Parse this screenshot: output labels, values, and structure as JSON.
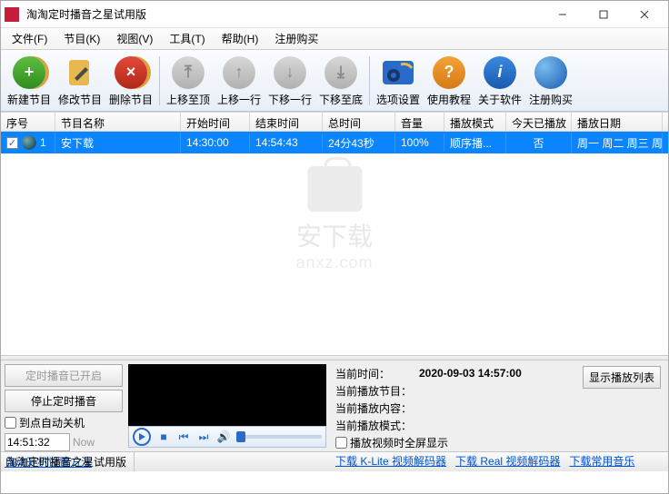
{
  "title": "淘淘定时播音之星试用版",
  "menu": [
    "文件(F)",
    "节目(K)",
    "视图(V)",
    "工具(T)",
    "帮助(H)",
    "注册购买"
  ],
  "toolbar": {
    "new": "新建节目",
    "edit": "修改节目",
    "delete": "删除节目",
    "moveTop": "上移至顶",
    "moveUp": "上移一行",
    "moveDown": "下移一行",
    "moveBottom": "下移至底",
    "options": "选项设置",
    "tutorial": "使用教程",
    "about": "关于软件",
    "register": "注册购买"
  },
  "columns": {
    "seq": "序号",
    "name": "节目名称",
    "start": "开始时间",
    "end": "结束时间",
    "total": "总时间",
    "vol": "音量",
    "mode": "播放模式",
    "today": "今天已播放",
    "date": "播放日期"
  },
  "rows": [
    {
      "seq": "1",
      "name": "安下载",
      "start": "14:30:00",
      "end": "14:54:43",
      "total": "24分43秒",
      "vol": "100%",
      "mode": "顺序播...",
      "today": "否",
      "date": "周一 周二 周三 周..."
    }
  ],
  "watermark": {
    "line1": "安下载",
    "line2": "anxz.com"
  },
  "bottom": {
    "timerOn": "定时播音已开启",
    "stopTimer": "停止定时播音",
    "autoShutdown": "到点自动关机",
    "timeValue": "14:51:32",
    "now": "Now",
    "autobootLink": "自动开机设置方法"
  },
  "info": {
    "curTimeLabel": "当前时间：",
    "curTimeVal": "2020-09-03 14:57:00",
    "curProgramLabel": "当前播放节目：",
    "curContentLabel": "当前播放内容：",
    "curModeLabel": "当前播放模式：",
    "fullscreenChk": "播放视频时全屏显示",
    "showListBtn": "显示播放列表",
    "link1": "下载 K-Lite 视频解码器",
    "link2": "下载 Real 视频解码器",
    "link3": "下载常用音乐"
  },
  "status": "淘淘定时播音之星试用版"
}
